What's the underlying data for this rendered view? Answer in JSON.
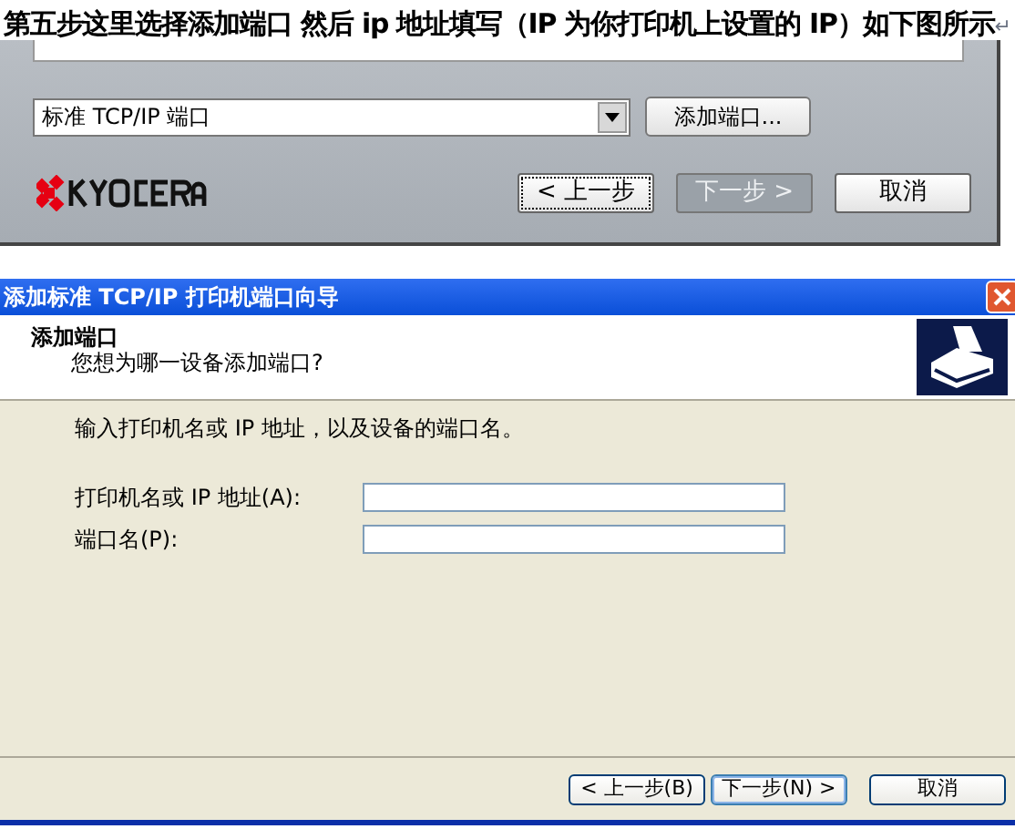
{
  "heading": {
    "text": "第五步这里选择添加端口 然后 ip 地址填写（IP 为你打印机上设置的 IP）如下图所示",
    "paragraph_mark": "↵"
  },
  "installer": {
    "port_select": {
      "value": "标准 TCP/IP 端口"
    },
    "add_port_button": "添加端口...",
    "buttons": [
      {
        "label": "< 上一步",
        "disabled": false,
        "focused": true
      },
      {
        "label": "下一步 >",
        "disabled": true,
        "focused": false
      },
      {
        "label": "取消",
        "disabled": false,
        "focused": false
      }
    ]
  },
  "wizard": {
    "window": {
      "title": "添加标准 TCP/IP 打印机端口向导"
    },
    "header": {
      "title": "添加端口",
      "subtitle": "您想为哪一设备添加端口?"
    },
    "instruction": "输入打印机名或 IP 地址，以及设备的端口名。",
    "fields": [
      {
        "label": "打印机名或 IP 地址(A):"
      },
      {
        "label": "端口名(P):"
      }
    ],
    "buttons": [
      {
        "label": "< 上一步(B)",
        "default": false
      },
      {
        "label": "下一步(N) >",
        "default": true
      },
      {
        "label": "取消",
        "default": false
      }
    ]
  }
}
